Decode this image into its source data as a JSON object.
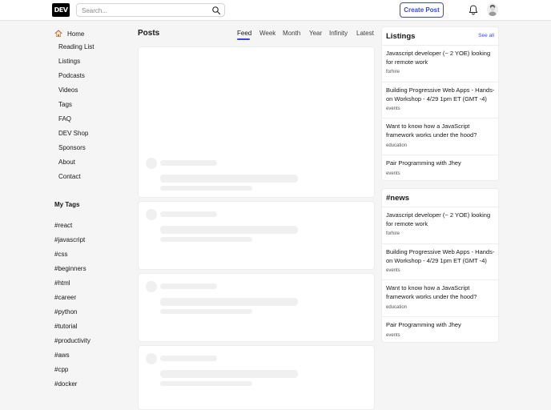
{
  "header": {
    "logo": "DEV",
    "search_placeholder": "Search...",
    "create_post": "Create Post"
  },
  "sidebar": {
    "items": [
      {
        "label": "Home"
      },
      {
        "label": "Reading List"
      },
      {
        "label": "Listings"
      },
      {
        "label": "Podcasts"
      },
      {
        "label": "Videos"
      },
      {
        "label": "Tags"
      },
      {
        "label": "FAQ"
      },
      {
        "label": "DEV Shop"
      },
      {
        "label": "Sponsors"
      },
      {
        "label": "About"
      },
      {
        "label": "Contact"
      }
    ],
    "my_tags_title": "My Tags",
    "tags": [
      "#react",
      "#javascript",
      "#css",
      "#beginners",
      "#html",
      "#career",
      "#python",
      "#tutorial",
      "#productivity",
      "#aws",
      "#cpp",
      "#docker"
    ]
  },
  "main": {
    "title": "Posts",
    "tabs": [
      "Feed",
      "Week",
      "Month",
      "Year",
      "Infinity",
      "Latest"
    ],
    "active_tab": "Feed"
  },
  "listings": {
    "title": "Listings",
    "see_all": "See all",
    "items": [
      {
        "title": "Javascript developer (~ 2 YOE) looking for remote work",
        "tag": "forhire"
      },
      {
        "title": "Building Progressive Web Apps - Hands-on Workshop - 4/29 1pm ET (GMT -4)",
        "tag": "events"
      },
      {
        "title": "Want to know how a JavaScript framework works under the hood?",
        "tag": "education"
      },
      {
        "title": "Pair Programming with Jhey",
        "tag": "events"
      }
    ]
  },
  "news": {
    "title": "#news",
    "items": [
      {
        "title": "Javascript developer (~ 2 YOE) looking for remote work",
        "tag": "forhire"
      },
      {
        "title": "Building Progressive Web Apps - Hands-on Workshop - 4/29 1pm ET (GMT -4)",
        "tag": "events"
      },
      {
        "title": "Want to know how a JavaScript framework works under the hood?",
        "tag": "education"
      },
      {
        "title": "Pair Programming with Jhey",
        "tag": "events"
      }
    ]
  },
  "colors": {
    "accent": "#3b49df",
    "background": "#f5f5f5",
    "skeleton": "#f0f0f0"
  }
}
